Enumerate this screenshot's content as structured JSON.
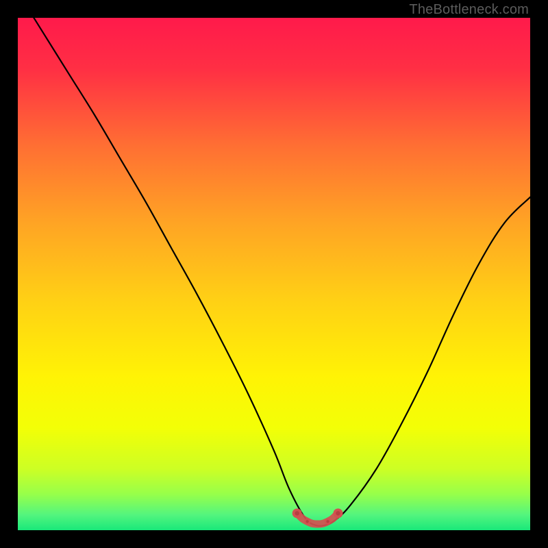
{
  "watermark": "TheBottleneck.com",
  "chart_data": {
    "type": "line",
    "title": "",
    "xlabel": "",
    "ylabel": "",
    "xlim": [
      0,
      100
    ],
    "ylim": [
      0,
      100
    ],
    "series": [
      {
        "name": "bottleneck-curve",
        "x": [
          0,
          5,
          10,
          15,
          20,
          25,
          30,
          35,
          40,
          45,
          50,
          53,
          56,
          58,
          60,
          62,
          65,
          70,
          75,
          80,
          85,
          90,
          95,
          100
        ],
        "values": [
          105,
          97,
          89,
          81,
          72.5,
          64,
          55,
          46,
          36.5,
          26.5,
          15.5,
          8,
          2.5,
          1,
          1,
          2,
          5,
          12,
          21,
          31,
          42,
          52,
          60,
          65
        ]
      },
      {
        "name": "valley-marker",
        "x": [
          54.5,
          55.5,
          56.5,
          57.5,
          58.5,
          59.5,
          60.5,
          61.5,
          62.5
        ],
        "values": [
          3.3,
          2.3,
          1.7,
          1.3,
          1.2,
          1.3,
          1.7,
          2.3,
          3.3
        ]
      }
    ],
    "gradient_stops": [
      {
        "offset": 0.0,
        "color": "#ff1a4b"
      },
      {
        "offset": 0.1,
        "color": "#ff2f44"
      },
      {
        "offset": 0.25,
        "color": "#ff6f33"
      },
      {
        "offset": 0.4,
        "color": "#ffa424"
      },
      {
        "offset": 0.55,
        "color": "#ffd015"
      },
      {
        "offset": 0.7,
        "color": "#fff305"
      },
      {
        "offset": 0.8,
        "color": "#f3ff06"
      },
      {
        "offset": 0.88,
        "color": "#cdff24"
      },
      {
        "offset": 0.93,
        "color": "#97ff4a"
      },
      {
        "offset": 0.97,
        "color": "#53f57e"
      },
      {
        "offset": 1.0,
        "color": "#19e87a"
      }
    ],
    "marker_color": "#d25050",
    "marker_inner": "#b63f40"
  }
}
